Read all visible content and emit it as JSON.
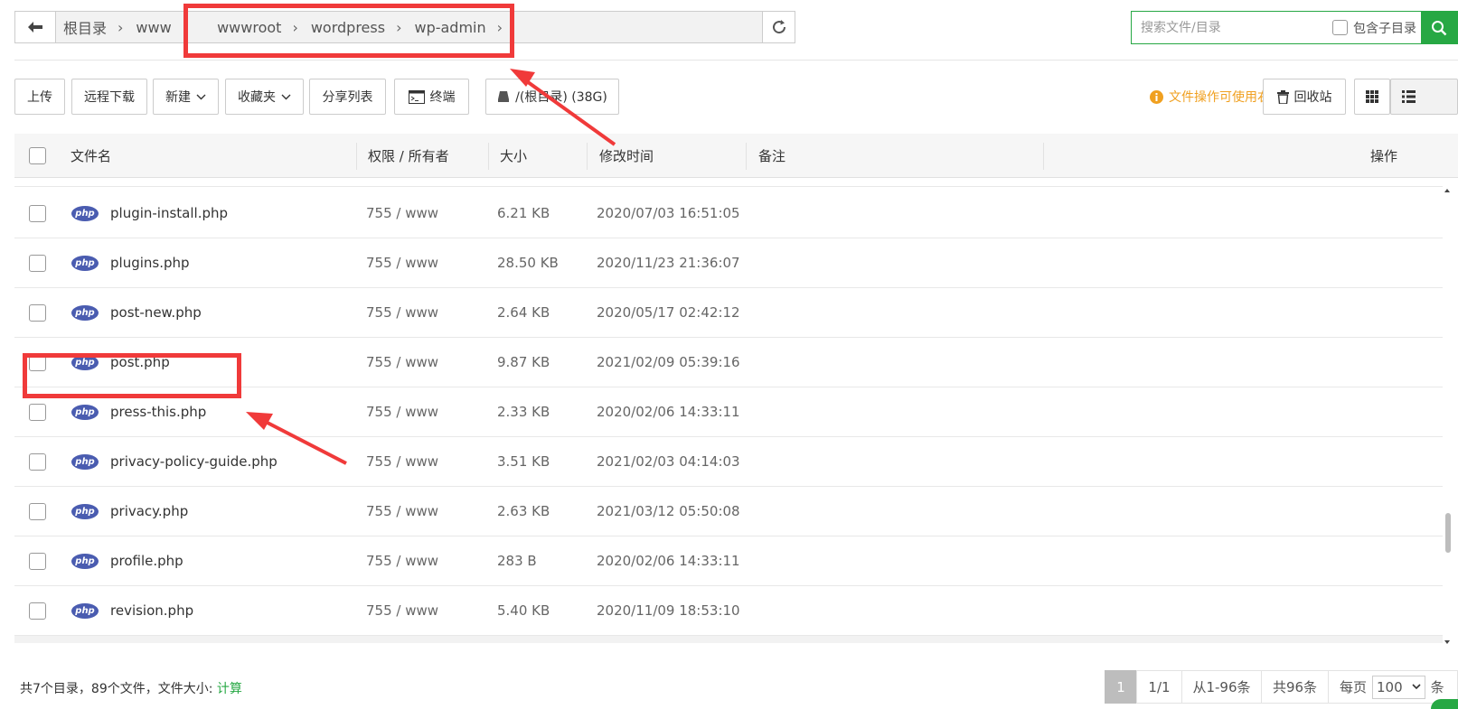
{
  "path": {
    "crumbs": [
      "根目录",
      "www",
      "wwwroot",
      "wordpress",
      "wp-admin"
    ]
  },
  "search": {
    "placeholder": "搜索文件/目录",
    "subdir_label": "包含子目录"
  },
  "toolbar": {
    "upload": "上传",
    "remote_download": "远程下载",
    "new": "新建",
    "favorites": "收藏夹",
    "share_list": "分享列表",
    "terminal": "终端",
    "disk": "/(根目录) (38G)",
    "hint": "文件操作可使用右键",
    "recycle": "回收站"
  },
  "table": {
    "headers": {
      "name": "文件名",
      "perm": "权限 / 所有者",
      "size": "大小",
      "mtime": "修改时间",
      "note": "备注",
      "ops": "操作"
    },
    "icon_text": "php",
    "rows": [
      {
        "name": "plugin-install.php",
        "perm": "755 / www",
        "size": "6.21 KB",
        "mtime": "2020/07/03 16:51:05"
      },
      {
        "name": "plugins.php",
        "perm": "755 / www",
        "size": "28.50 KB",
        "mtime": "2020/11/23 21:36:07"
      },
      {
        "name": "post-new.php",
        "perm": "755 / www",
        "size": "2.64 KB",
        "mtime": "2020/05/17 02:42:12"
      },
      {
        "name": "post.php",
        "perm": "755 / www",
        "size": "9.87 KB",
        "mtime": "2021/02/09 05:39:16"
      },
      {
        "name": "press-this.php",
        "perm": "755 / www",
        "size": "2.33 KB",
        "mtime": "2020/02/06 14:33:11"
      },
      {
        "name": "privacy-policy-guide.php",
        "perm": "755 / www",
        "size": "3.51 KB",
        "mtime": "2021/02/03 04:14:03"
      },
      {
        "name": "privacy.php",
        "perm": "755 / www",
        "size": "2.63 KB",
        "mtime": "2021/03/12 05:50:08"
      },
      {
        "name": "profile.php",
        "perm": "755 / www",
        "size": "283 B",
        "mtime": "2020/02/06 14:33:11"
      },
      {
        "name": "revision.php",
        "perm": "755 / www",
        "size": "5.40 KB",
        "mtime": "2020/11/09 18:53:10"
      }
    ]
  },
  "footer": {
    "summary": "共7个目录，89个文件，文件大小: ",
    "calc": "计算",
    "page_current": "1",
    "page_of": "1/1",
    "range": "从1-96条",
    "total": "共96条",
    "per_page_label": "每页",
    "per_page_value": "100",
    "unit": "条"
  },
  "colors": {
    "accent": "#27a844",
    "annotation": "#f03a3a",
    "hint": "#f0a020"
  }
}
